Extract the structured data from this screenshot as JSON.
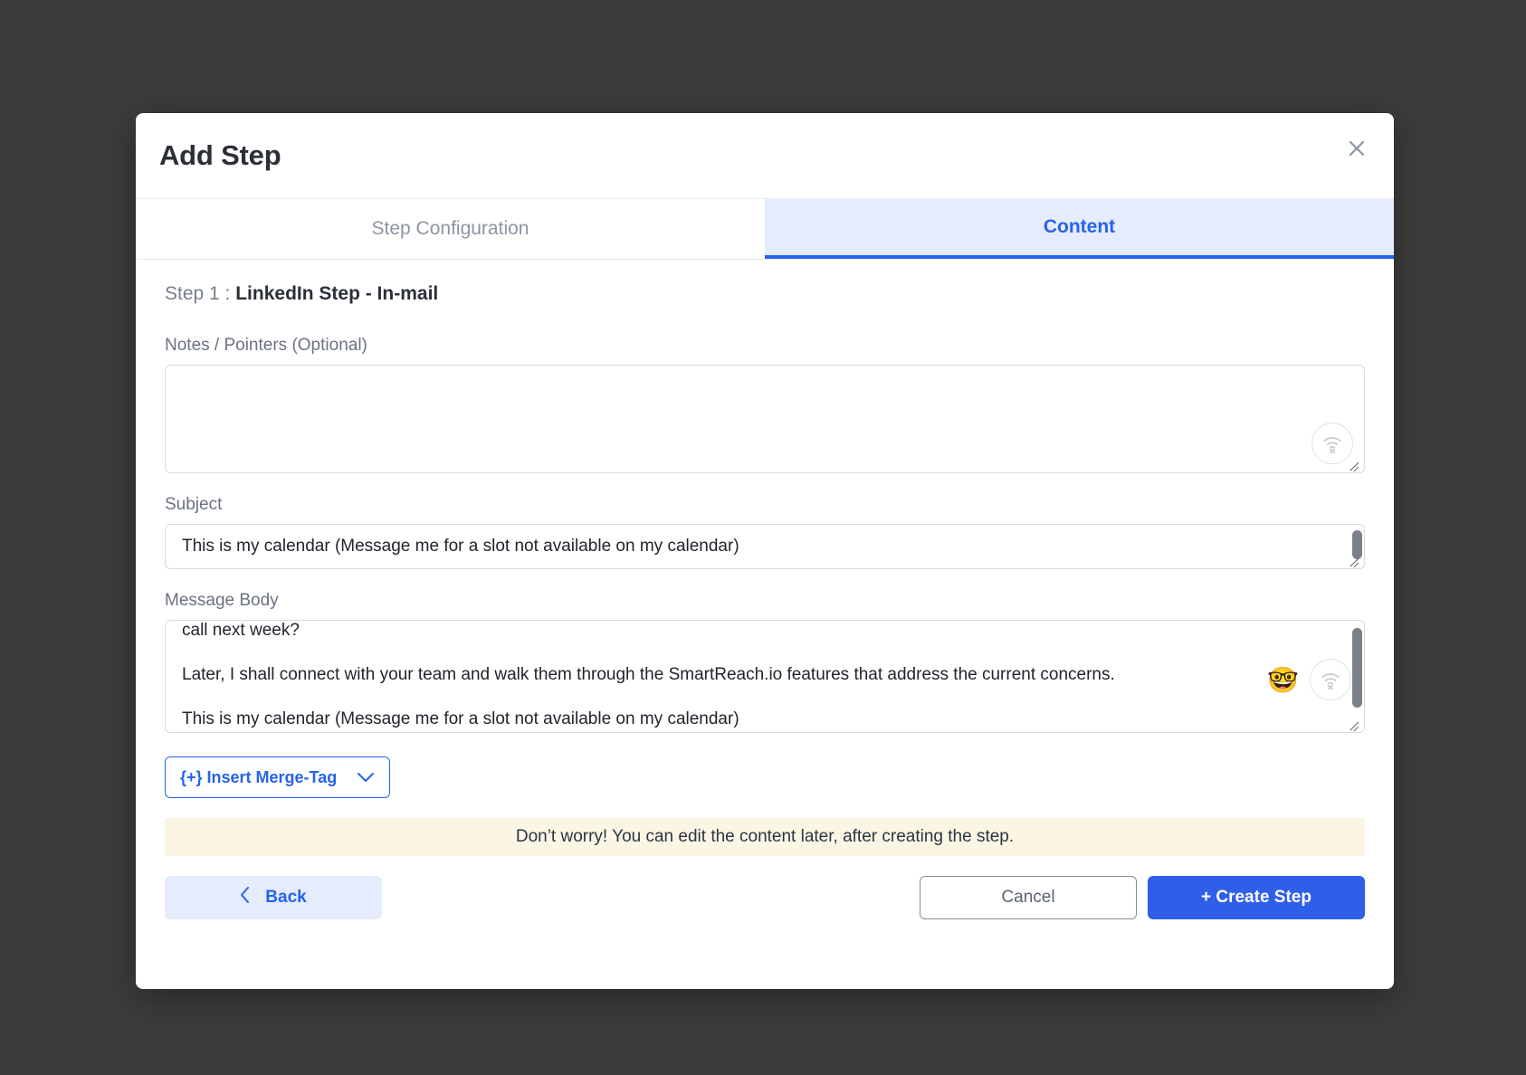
{
  "modal": {
    "title": "Add Step",
    "close_icon": "close-icon"
  },
  "tabs": [
    {
      "label": "Step Configuration",
      "active": false
    },
    {
      "label": "Content",
      "active": true
    }
  ],
  "step": {
    "prefix": "Step 1 : ",
    "name": "LinkedIn Step - In-mail"
  },
  "notes": {
    "label": "Notes / Pointers (Optional)",
    "value": "",
    "placeholder": ""
  },
  "subject": {
    "label": "Subject",
    "value": "This is my calendar (Message me for a slot not available on my calendar)"
  },
  "message_body": {
    "label": "Message Body",
    "lines": [
      "call next week?",
      "Later, I shall connect with your team and walk them through the SmartReach.io features that address the current concerns.",
      "This is my calendar (Message me for a slot not available on my calendar)"
    ],
    "emoji": "🤓"
  },
  "merge_tag": {
    "label": "{+} Insert Merge-Tag",
    "chevron": "⌄"
  },
  "notice": {
    "text": "Don’t worry! You can edit the content later, after creating the step."
  },
  "footer": {
    "back_label": "Back",
    "back_chevron": "‹",
    "cancel_label": "Cancel",
    "create_label": "+ Create Step"
  },
  "colors": {
    "accent": "#2563eb",
    "primary_button": "#2f5fe8",
    "tab_active_bg": "#e5ecfd",
    "notice_bg": "#fbf6e3",
    "overlay": "#3c3c3c"
  }
}
